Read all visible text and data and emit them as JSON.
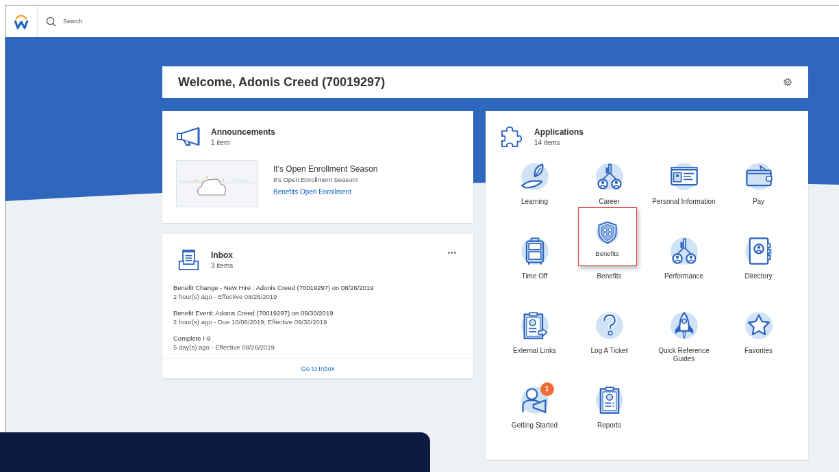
{
  "header": {
    "search": {
      "placeholder": "Search"
    }
  },
  "welcome": {
    "title": "Welcome, Adonis Creed (70019297)"
  },
  "announcements": {
    "title": "Announcements",
    "count": "1 item",
    "items": [
      {
        "title": "It's Open Enrollment Season",
        "text": "It's Open Enrollment Season!",
        "link": "Benefits Open Enrollment"
      }
    ]
  },
  "inbox": {
    "title": "Inbox",
    "count": "3 items",
    "menu": "•••",
    "items": [
      {
        "title": "Benefit Change - New Hire : Adonis Creed (70019297) on 08/26/2019",
        "meta": "2 hour(s) ago - Effective 08/26/2019"
      },
      {
        "title": "Benefit Event: Adonis Creed (70019297) on 09/30/2019",
        "meta": "2 hour(s) ago - Due 10/08/2019; Effective 09/30/2019"
      },
      {
        "title": "Complete I-9",
        "meta": "5 day(s) ago - Effective 08/26/2019"
      }
    ],
    "footer_link": "Go to Inbox"
  },
  "applications": {
    "title": "Applications",
    "count": "14 items",
    "items": [
      {
        "label": "Learning",
        "highlighted": false
      },
      {
        "label": "Career",
        "highlighted": false
      },
      {
        "label": "Personal Information",
        "highlighted": false
      },
      {
        "label": "Pay",
        "highlighted": false
      },
      {
        "label": "Time Off",
        "highlighted": false
      },
      {
        "label": "Benefits",
        "highlighted": true,
        "callout_label": "Benefits"
      },
      {
        "label": "Performance",
        "highlighted": false
      },
      {
        "label": "Directory",
        "highlighted": false
      },
      {
        "label": "External Links",
        "highlighted": false
      },
      {
        "label": "Log A Ticket",
        "highlighted": false
      },
      {
        "label": "Quick Reference Guides",
        "highlighted": false
      },
      {
        "label": "Favorites",
        "highlighted": false
      },
      {
        "label": "Getting Started",
        "highlighted": false,
        "badge": "1"
      },
      {
        "label": "Reports",
        "highlighted": false
      }
    ]
  }
}
